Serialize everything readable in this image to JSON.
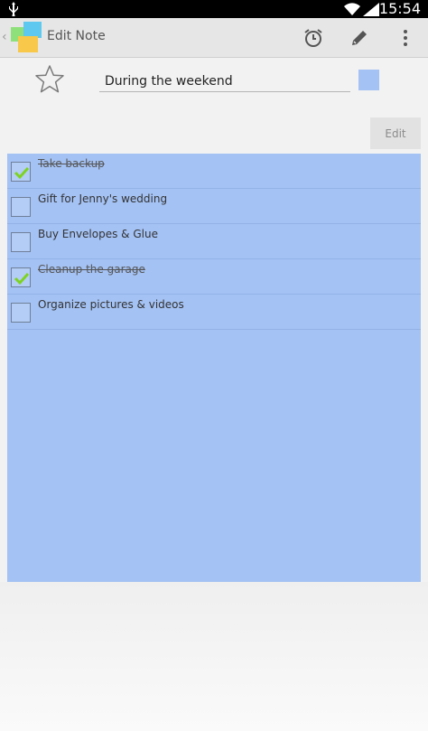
{
  "status_bar": {
    "time": "15:54",
    "usb_icon": "usb-icon",
    "wifi_icon": "wifi-icon",
    "signal_icon": "signal-icon"
  },
  "action_bar": {
    "title": "Edit Note",
    "icons": [
      "app-icon",
      "alarm-icon",
      "pencil-icon",
      "overflow-menu-icon"
    ]
  },
  "note": {
    "title": "During the weekend",
    "starred": false,
    "color": "#a4c2f4",
    "edit_label": "Edit"
  },
  "items": [
    {
      "text": "Take backup",
      "checked": true
    },
    {
      "text": "Gift for Jenny's wedding",
      "checked": false
    },
    {
      "text": "Buy Envelopes & Glue",
      "checked": false
    },
    {
      "text": "Cleanup the garage",
      "checked": true
    },
    {
      "text": "Organize pictures & videos",
      "checked": false
    }
  ],
  "colors": {
    "panel": "#a4c2f4",
    "check": "#7ed321"
  }
}
